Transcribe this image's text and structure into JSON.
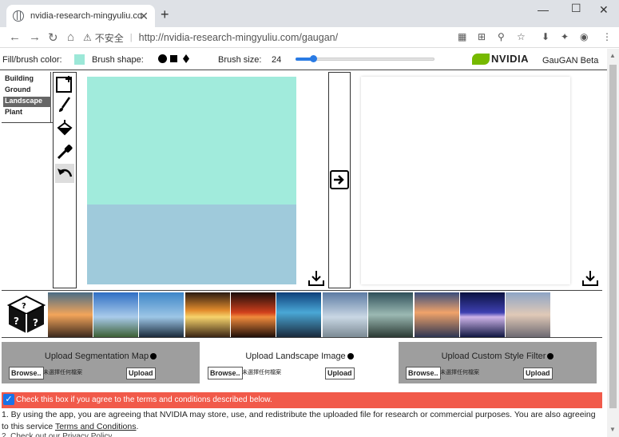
{
  "browser": {
    "tab_title": "nvidia-research-mingyuliu.com",
    "insecure_label": "不安全",
    "url": "http://nvidia-research-mingyuliu.com/gaugan/"
  },
  "toolbar": {
    "fill_label": "Fill/brush color:",
    "fill_color": "#9ce8d8",
    "shape_label": "Brush shape:",
    "size_label": "Brush size:",
    "size_value": "24",
    "brand": "NVIDIA",
    "product": "GauGAN Beta"
  },
  "categories": [
    {
      "label": "Building",
      "active": false
    },
    {
      "label": "Ground",
      "active": false
    },
    {
      "label": "Landscape",
      "active": true
    },
    {
      "label": "Plant",
      "active": false
    }
  ],
  "tools": [
    "new-canvas-icon",
    "brush-icon",
    "paint-bucket-icon",
    "eyedropper-icon",
    "undo-icon"
  ],
  "canvas": {
    "sky_color": "#a1ebdc",
    "sea_color": "#9fcadb"
  },
  "uploads": [
    {
      "title": "Upload Segmentation Map",
      "browse": "Browse..",
      "nofile": "未選擇任何檔案",
      "upload": "Upload"
    },
    {
      "title": "Upload Landscape Image",
      "browse": "Browse..",
      "nofile": "未選擇任何檔案",
      "upload": "Upload"
    },
    {
      "title": "Upload Custom Style Filter",
      "browse": "Browse..",
      "nofile": "未選擇任何檔案",
      "upload": "Upload"
    }
  ],
  "terms": {
    "checkbox_label": "Check this box if you agree to the terms and conditions described below.",
    "item1_text": "1. By using the app, you are agreeing that NVIDIA may store, use, and redistribute the uploaded file for research or commercial purposes. You are also agreeing to this service",
    "item1_link": "Terms and Conditions",
    "item2_cut": "2. Check out our Privacy Policy"
  }
}
